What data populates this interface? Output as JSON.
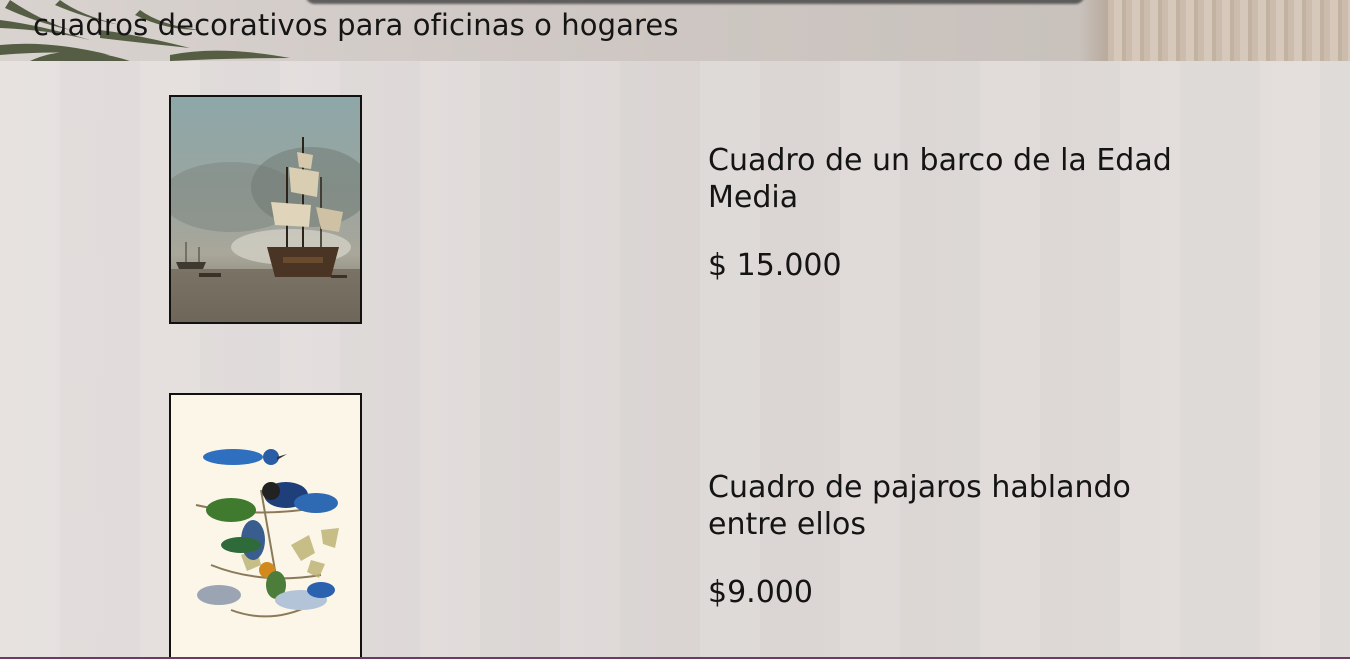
{
  "header": {
    "title": "cuadros decorativos para oficinas o hogares"
  },
  "products": [
    {
      "name": "Cuadro de un barco de la Edad Media",
      "price": "$ 15.000",
      "image_icon": "ship-painting-image"
    },
    {
      "name": "Cuadro de pajaros hablando entre ellos",
      "price": "$9.000",
      "image_icon": "birds-painting-image"
    }
  ],
  "colors": {
    "background": "#e2dddc",
    "text": "#141414",
    "frame_border": "#111111"
  }
}
